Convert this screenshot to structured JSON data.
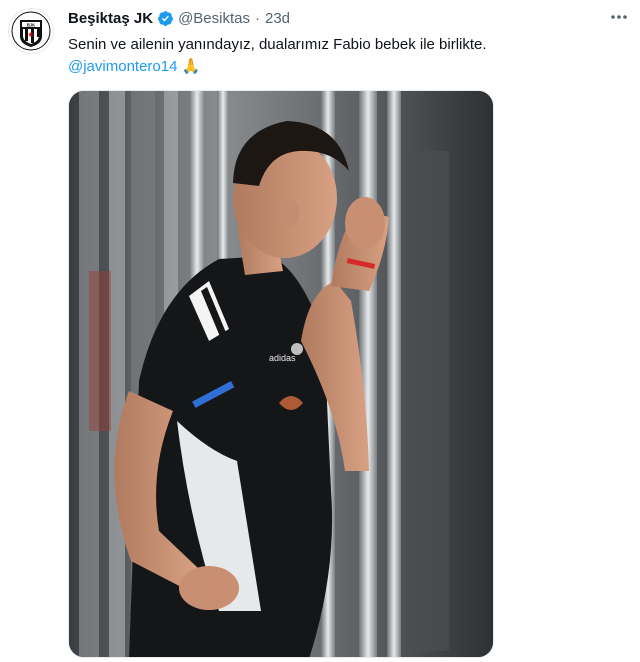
{
  "tweet": {
    "author_name": "Beşiktaş JK",
    "verified_icon": "verified-badge-icon",
    "handle": "@Besiktas",
    "separator": "·",
    "timestamp": "23d",
    "more_icon": "more-options-icon",
    "text_line1": "Senin ve ailenin yanındayız, dualarımız Fabio bebek ile birlikte.",
    "mention": "@javimontero14",
    "emoji": "🙏",
    "accent_color": "#1d9bf0",
    "text_color": "#0f1419",
    "muted_color": "#536471"
  },
  "avatar": {
    "icon": "besiktas-crest-icon",
    "logo_text": "BJK",
    "logo_year": "1903"
  },
  "media": {
    "icon": "tweet-photo",
    "jersey_brand": "adidas"
  }
}
